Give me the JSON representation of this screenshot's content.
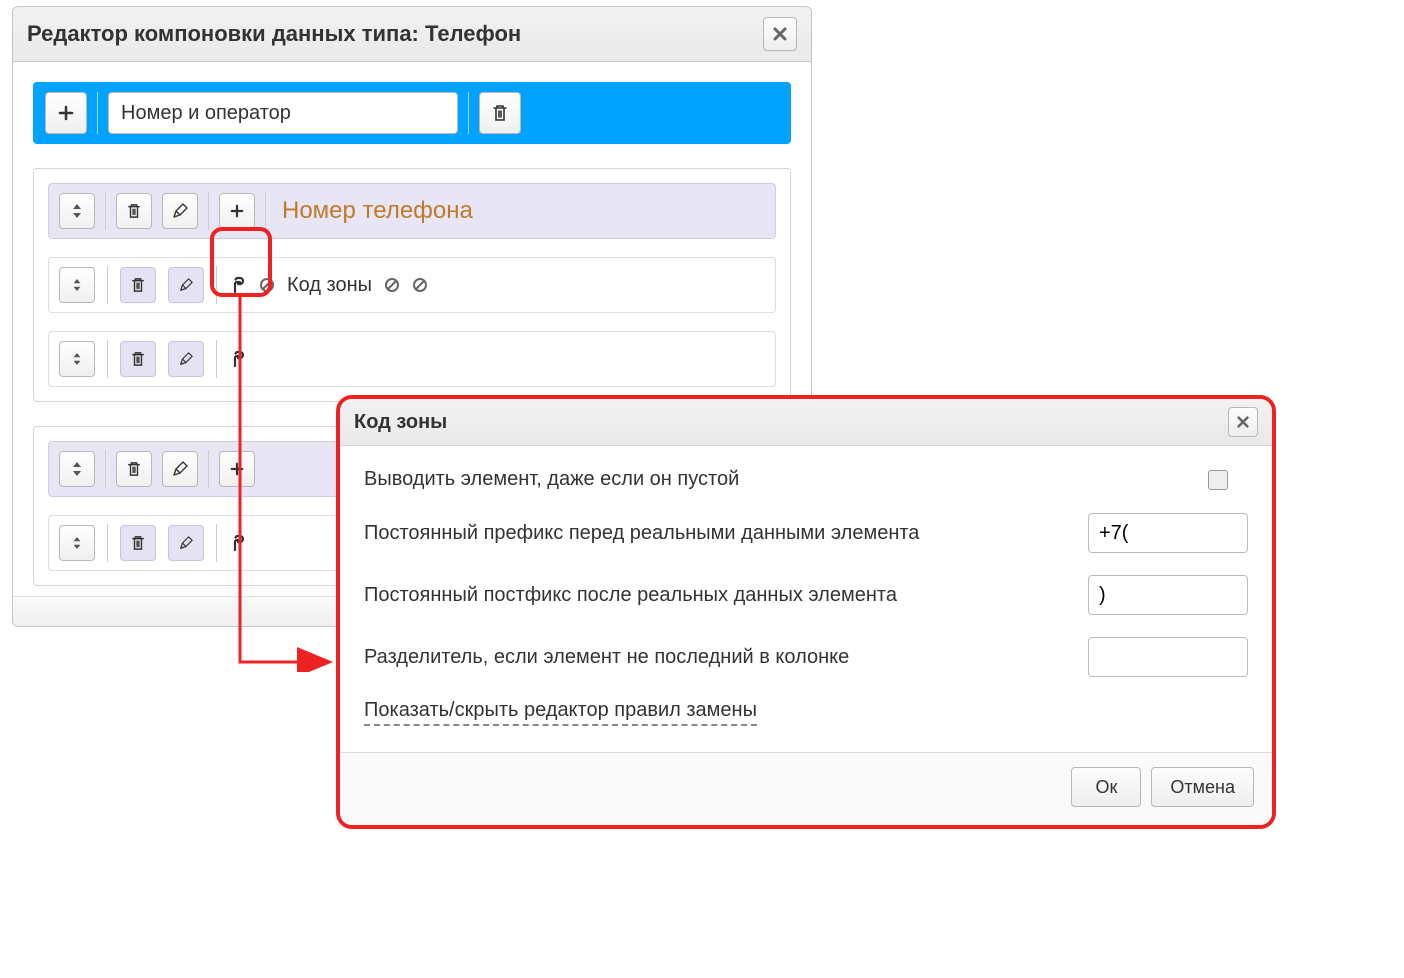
{
  "editor": {
    "title": "Редактор компоновки данных типа: Телефон",
    "section": {
      "name_value": "Номер и оператор"
    },
    "composite1": {
      "label": "Номер телефона",
      "child1_label": "Код зоны"
    }
  },
  "dialog": {
    "title": "Код зоны",
    "rows": {
      "show_if_empty": "Выводить элемент, даже если он пустой",
      "prefix_label": "Постоянный префикс перед реальными данными элемента",
      "prefix_value": "+7(",
      "postfix_label": "Постоянный постфикс после реальных данных элемента",
      "postfix_value": ")",
      "separator_label": "Разделитель, если элемент не последний в колонке",
      "separator_value": "",
      "toggle_rules": "Показать/скрыть редактор правил замены"
    },
    "buttons": {
      "ok": "Ок",
      "cancel": "Отмена"
    }
  }
}
